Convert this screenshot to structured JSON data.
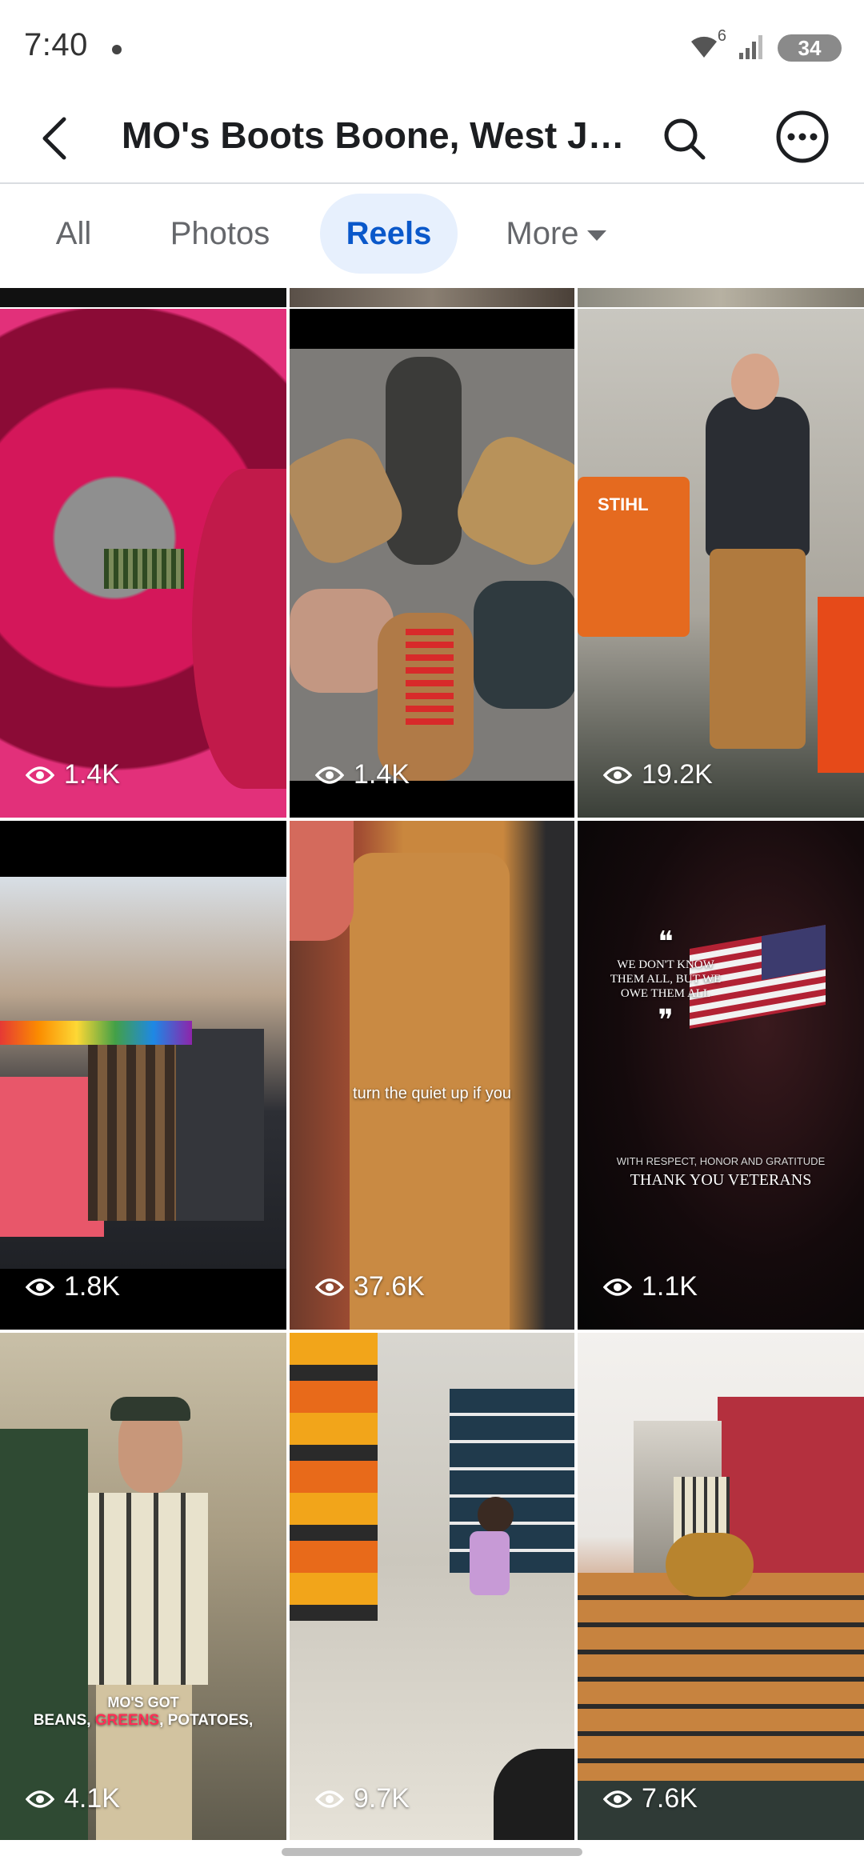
{
  "status_bar": {
    "time": "7:40",
    "wifi_badge": "6",
    "battery": "34"
  },
  "header": {
    "title": "MO's Boots Boone, West Je..."
  },
  "tabs": [
    {
      "label": "All",
      "active": false
    },
    {
      "label": "Photos",
      "active": false
    },
    {
      "label": "Reels",
      "active": true
    },
    {
      "label": "More",
      "active": false
    }
  ],
  "reels": [
    {
      "views": "1.4K"
    },
    {
      "views": "1.4K"
    },
    {
      "views": "19.2K",
      "sign_text": "STIHL"
    },
    {
      "views": "1.8K"
    },
    {
      "views": "37.6K",
      "caption": "turn the quiet up if you"
    },
    {
      "views": "1.1K",
      "quote_line1": "WE DON'T KNOW",
      "quote_line2": "THEM ALL, BUT WE",
      "quote_line3": "OWE THEM ALL",
      "subtitle": "WITH RESPECT, HONOR AND GRATITUDE",
      "title": "THANK YOU VETERANS"
    },
    {
      "views": "4.1K",
      "caption_line1": "MO'S GOT",
      "caption_line2_a": "BEANS, ",
      "caption_line2_b": "GREENS",
      "caption_line2_c": ", POTATOES,"
    },
    {
      "views": "9.7K"
    },
    {
      "views": "7.6K"
    }
  ],
  "colors": {
    "accent": "#0a58ca",
    "active_tab_bg": "#e7f0fd",
    "highlight_red": "#ff2d55"
  }
}
